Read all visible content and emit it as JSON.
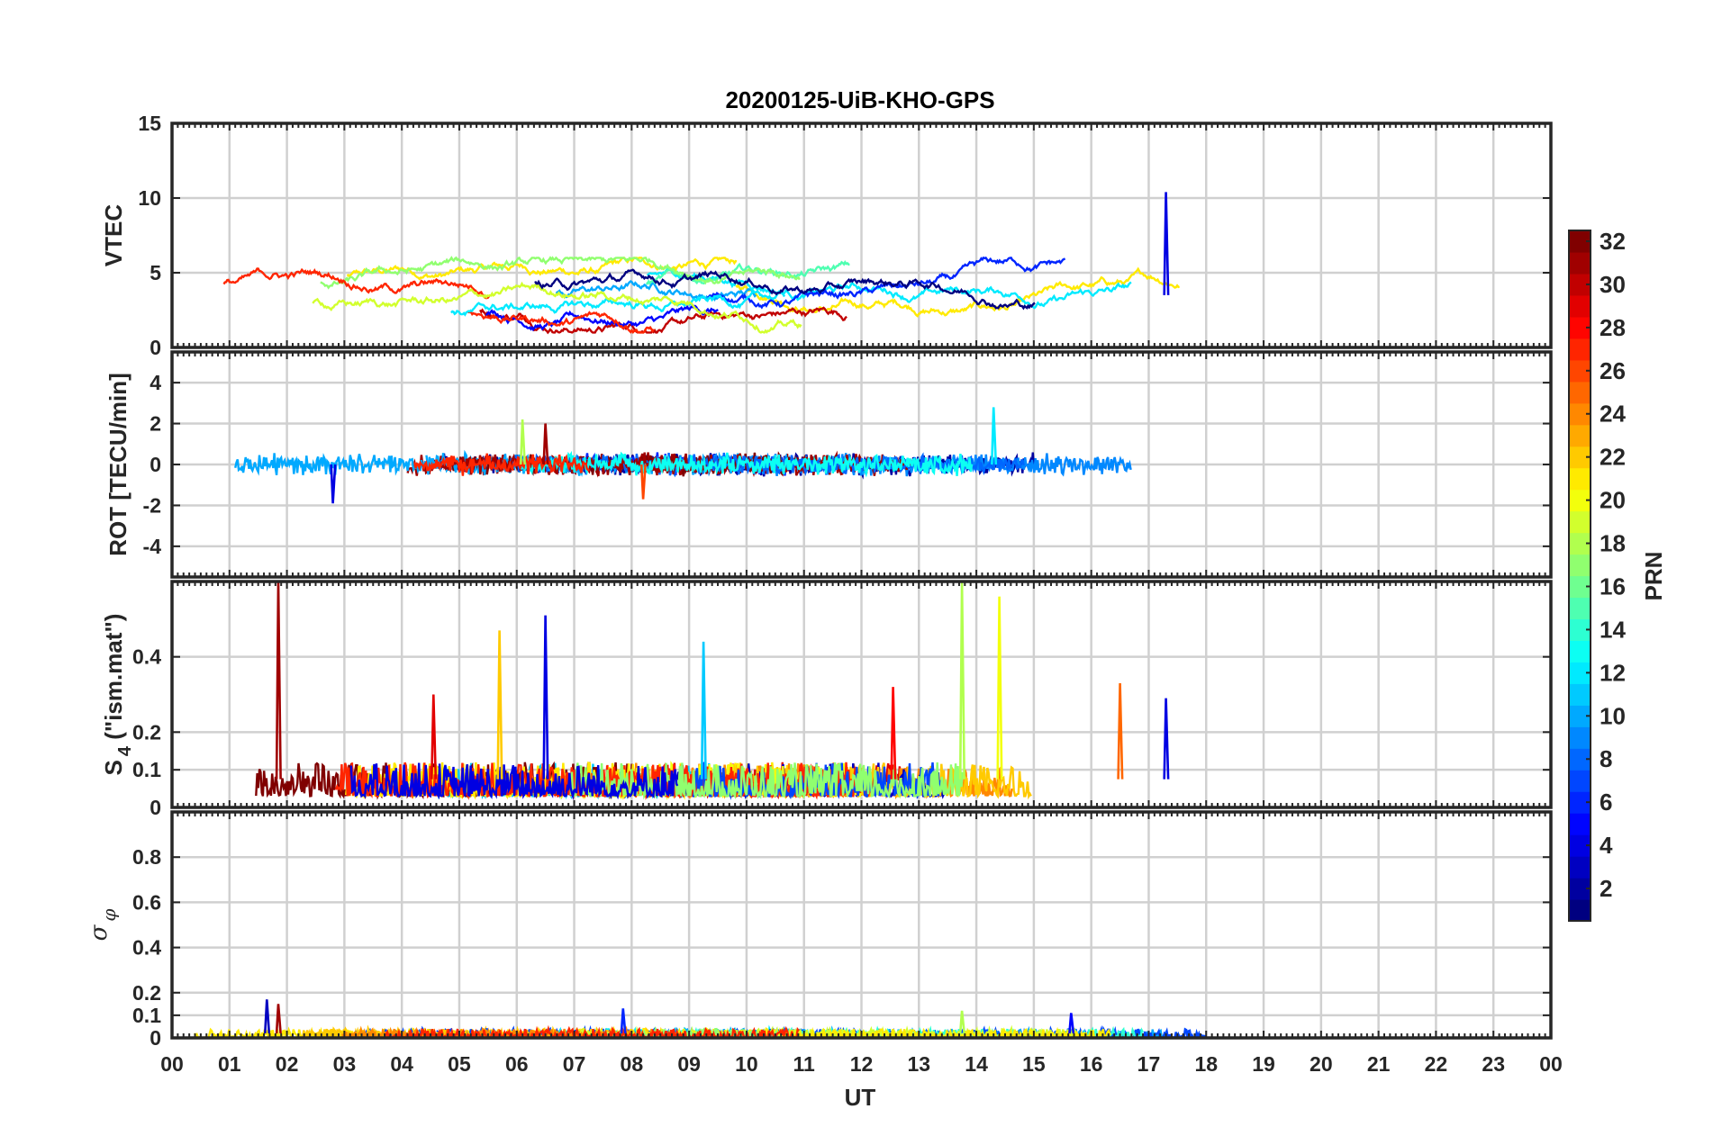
{
  "chart_data": {
    "type": "line",
    "title": "20200125-UiB-KHO-GPS",
    "xlabel": "UT",
    "x_tick_labels": [
      "00",
      "01",
      "02",
      "03",
      "04",
      "05",
      "06",
      "07",
      "08",
      "09",
      "10",
      "11",
      "12",
      "13",
      "14",
      "15",
      "16",
      "17",
      "18",
      "19",
      "20",
      "21",
      "22",
      "23",
      "00"
    ],
    "xlim": [
      0,
      24
    ],
    "data_end_hour": 18,
    "grid": true,
    "panels": [
      {
        "id": "vtec",
        "ylabel": "VTEC",
        "ylim": [
          0,
          15
        ],
        "yticks": [
          0,
          5,
          10,
          15
        ],
        "ytick_labels": [
          "0",
          "5",
          "10",
          "15"
        ],
        "typical_range": [
          1,
          6
        ],
        "spikes": [
          {
            "x": 17.3,
            "y": 10.4,
            "prn": 4
          }
        ]
      },
      {
        "id": "rot",
        "ylabel": "ROT [TECU/min]",
        "ylim": [
          -5.5,
          5.5
        ],
        "yticks": [
          -4,
          -2,
          0,
          2,
          4
        ],
        "ytick_labels": [
          "-4",
          "-2",
          "0",
          "2",
          "4"
        ],
        "typical_range": [
          -0.6,
          0.6
        ],
        "spikes": [
          {
            "x": 2.8,
            "y": -1.9,
            "prn": 4
          },
          {
            "x": 6.1,
            "y": 2.2,
            "prn": 18
          },
          {
            "x": 6.5,
            "y": 2.0,
            "prn": 31
          },
          {
            "x": 8.2,
            "y": -1.7,
            "prn": 26
          },
          {
            "x": 14.3,
            "y": 2.8,
            "prn": 12
          }
        ]
      },
      {
        "id": "s4",
        "ylabel": "S4 (\"ism.mat\")",
        "ylabel_main": "S",
        "ylabel_sub": "4",
        "ylabel_rest": " (\"ism.mat\")",
        "ylim": [
          0,
          0.6
        ],
        "yticks": [
          0,
          0.1,
          0.2,
          0.4
        ],
        "ytick_labels": [
          "0",
          "0.1",
          "0.2",
          "0.4"
        ],
        "typical_range": [
          0.03,
          0.12
        ],
        "spikes": [
          {
            "x": 1.85,
            "y": 0.6,
            "prn": 31
          },
          {
            "x": 4.55,
            "y": 0.3,
            "prn": 29
          },
          {
            "x": 5.7,
            "y": 0.47,
            "prn": 22
          },
          {
            "x": 6.5,
            "y": 0.51,
            "prn": 4
          },
          {
            "x": 9.25,
            "y": 0.44,
            "prn": 11
          },
          {
            "x": 12.55,
            "y": 0.32,
            "prn": 28
          },
          {
            "x": 13.75,
            "y": 0.6,
            "prn": 18
          },
          {
            "x": 14.4,
            "y": 0.56,
            "prn": 20
          },
          {
            "x": 16.5,
            "y": 0.33,
            "prn": 25
          },
          {
            "x": 17.3,
            "y": 0.29,
            "prn": 4
          }
        ]
      },
      {
        "id": "sigma_phi",
        "ylabel": "σ φ",
        "ylabel_main": "σ",
        "ylabel_sub": "φ",
        "ylim": [
          0,
          1
        ],
        "yticks": [
          0,
          0.1,
          0.2,
          0.4,
          0.6,
          0.8
        ],
        "ytick_labels": [
          "0",
          "0.1",
          "0.2",
          "0.4",
          "0.6",
          "0.8"
        ],
        "typical_range": [
          0.0,
          0.04
        ],
        "spikes": [
          {
            "x": 1.65,
            "y": 0.17,
            "prn": 3
          },
          {
            "x": 1.85,
            "y": 0.15,
            "prn": 31
          },
          {
            "x": 7.85,
            "y": 0.13,
            "prn": 6
          },
          {
            "x": 13.75,
            "y": 0.12,
            "prn": 18
          },
          {
            "x": 15.65,
            "y": 0.11,
            "prn": 5
          }
        ]
      }
    ],
    "colorbar": {
      "label": "PRN",
      "range": [
        1,
        32
      ],
      "ticks": [
        2,
        4,
        6,
        8,
        10,
        12,
        14,
        16,
        18,
        20,
        22,
        24,
        26,
        28,
        30,
        32
      ],
      "tick_labels": [
        "2",
        "4",
        "6",
        "8",
        "10",
        "12",
        "14",
        "16",
        "18",
        "20",
        "22",
        "24",
        "26",
        "28",
        "30",
        "32"
      ],
      "colormap": "jet"
    },
    "series_note_prns": [
      1,
      2,
      3,
      4,
      5,
      6,
      7,
      8,
      9,
      10,
      11,
      12,
      13,
      14,
      15,
      16,
      17,
      18,
      19,
      20,
      21,
      22,
      23,
      24,
      25,
      26,
      27,
      28,
      29,
      30,
      31,
      32
    ]
  }
}
